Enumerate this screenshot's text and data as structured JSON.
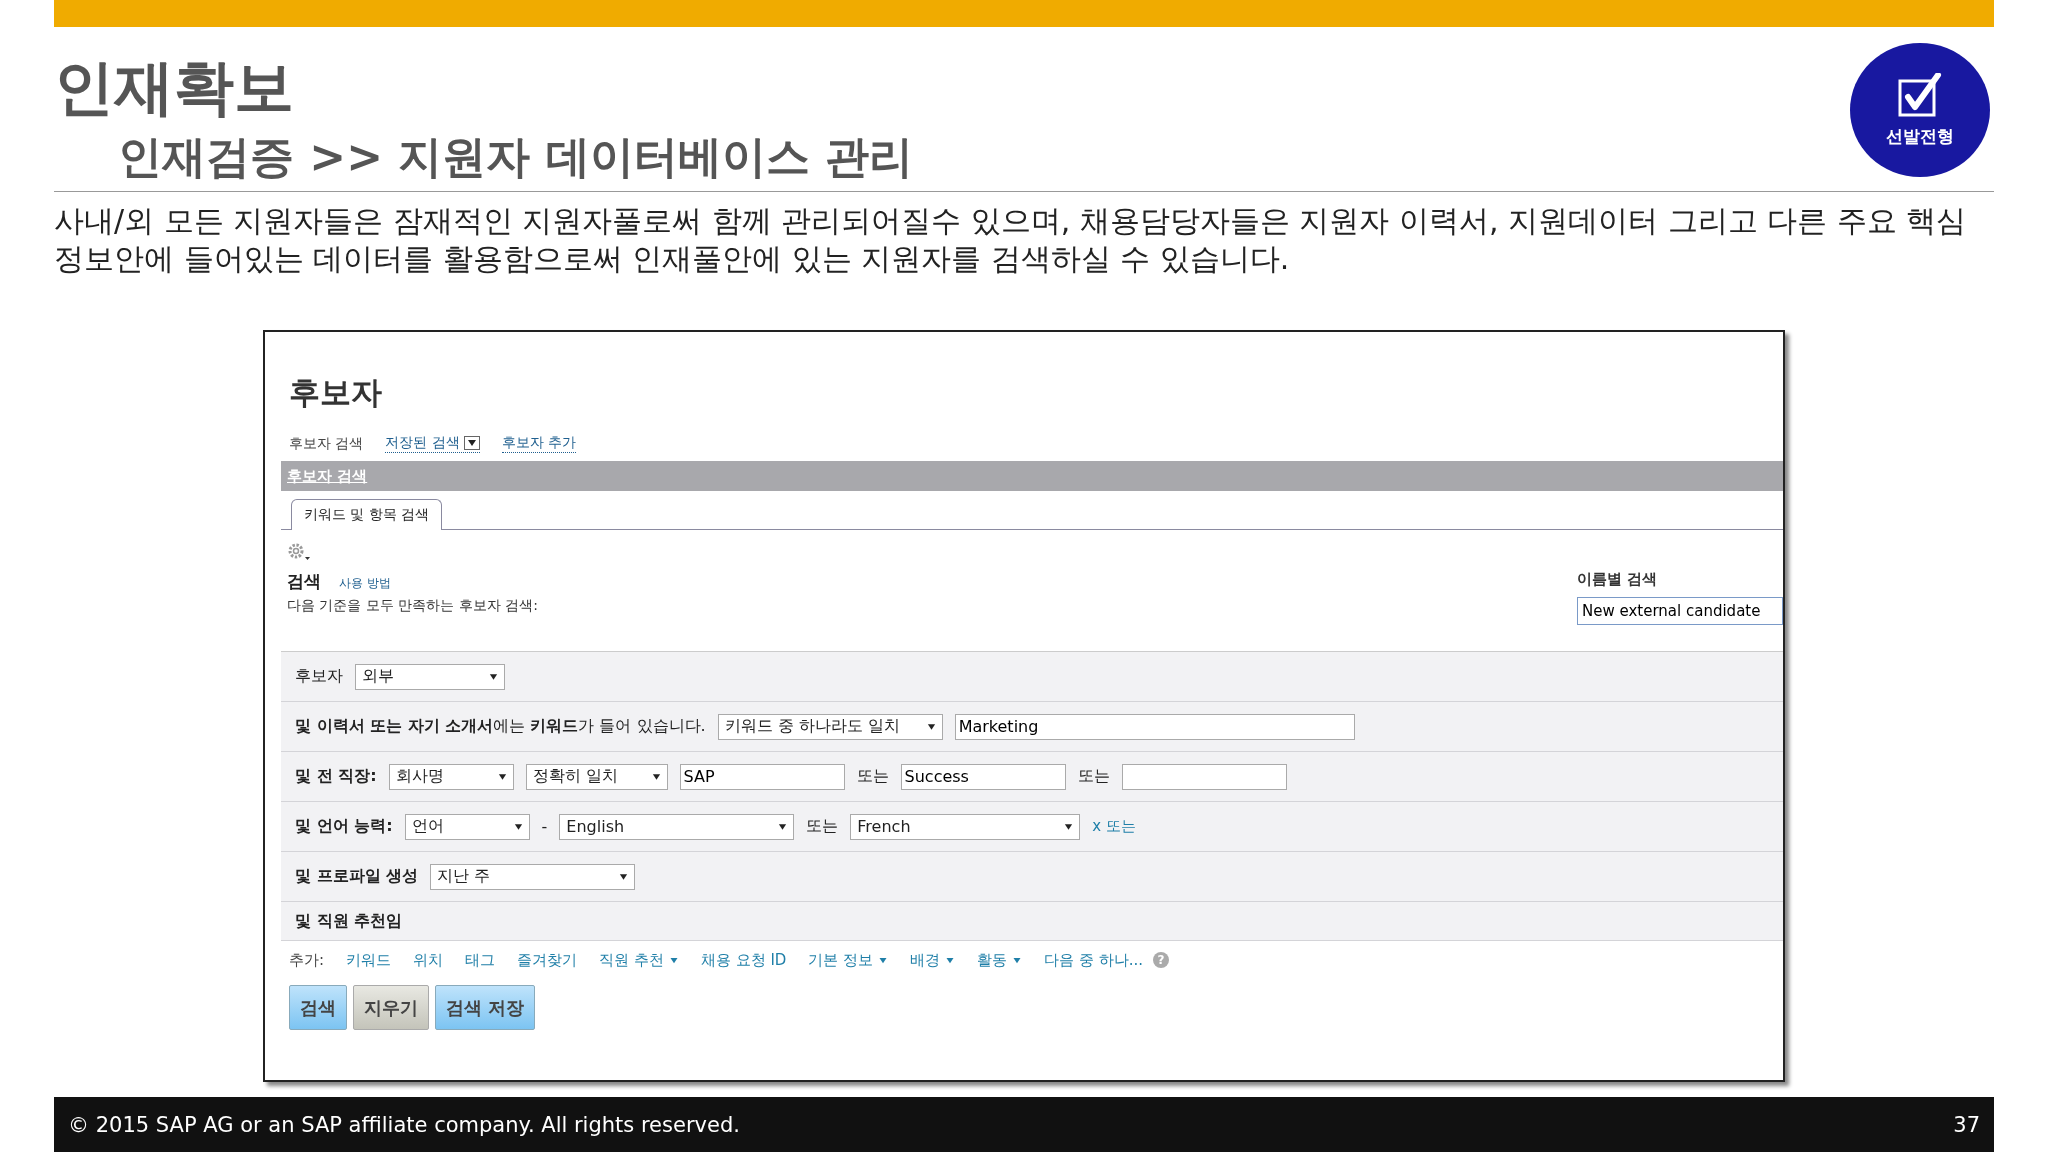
{
  "slide": {
    "title": "인재확보",
    "subtitle": "인재검증 >> 지원자 데이터베이스 관리",
    "badge": {
      "label": "선발전형"
    },
    "description": "사내/외 모든 지원자들은 잠재적인 지원자풀로써 함께 관리되어질수 있으며, 채용담당자들은 지원자 이력서, 지원데이터 그리고 다른 주요 핵심 정보안에 들어있는 데이터를 활용함으로써 인재풀안에 있는 지원자를 검색하실 수 있습니다."
  },
  "app": {
    "page_title": "후보자",
    "nav_links": [
      {
        "label": "후보자 검색",
        "kind": "plain"
      },
      {
        "label": "저장된 검색",
        "kind": "dropdown"
      },
      {
        "label": "후보자 추가",
        "kind": "link"
      }
    ],
    "section_bar": {
      "label": "후보자 검색"
    },
    "tabs": [
      {
        "label": "키워드 및 항목 검색",
        "selected": true
      }
    ],
    "search_heading": "검색",
    "help_link": "사용 방법",
    "criteria_intro": "다음 기준을 모두 만족하는 후보자 검색:",
    "name_search": {
      "label": "이름별 검색",
      "value": "New external candidate"
    },
    "criteria": [
      {
        "parts": [
          {
            "kind": "label",
            "text": "후보자",
            "bold": false
          },
          {
            "kind": "select",
            "value": "외부"
          }
        ]
      },
      {
        "parts": [
          {
            "kind": "label",
            "text": "**및 이력서 또는 자기 소개서**에는 **키워드**가 들어 있습니다.",
            "bold": false
          },
          {
            "kind": "select",
            "value": "키워드 중 하나라도 일치"
          },
          {
            "kind": "input",
            "value": "Marketing"
          }
        ]
      },
      {
        "parts": [
          {
            "kind": "label",
            "text": "및 전 직장:",
            "bold": true
          },
          {
            "kind": "select",
            "value": "회사명"
          },
          {
            "kind": "select",
            "value": "정확히 일치"
          },
          {
            "kind": "input",
            "value": "SAP"
          },
          {
            "kind": "text",
            "text": "또는"
          },
          {
            "kind": "input",
            "value": "Success"
          },
          {
            "kind": "text",
            "text": "또는"
          },
          {
            "kind": "input"
          }
        ]
      },
      {
        "parts": [
          {
            "kind": "label",
            "text": "및 언어 능력:",
            "bold": true
          },
          {
            "kind": "select",
            "value": "언어"
          },
          {
            "kind": "text",
            "text": "-"
          },
          {
            "kind": "select",
            "value": "English"
          },
          {
            "kind": "text",
            "text": "또는"
          },
          {
            "kind": "select",
            "value": "French"
          },
          {
            "kind": "link",
            "text": "x 또는"
          }
        ]
      },
      {
        "parts": [
          {
            "kind": "label",
            "text": "및 프로파일 생성",
            "bold": true
          },
          {
            "kind": "select",
            "value": "지난 주"
          }
        ]
      },
      {
        "parts": [
          {
            "kind": "label",
            "text": "및 직원 추천임",
            "bold": true
          }
        ]
      }
    ],
    "add_label": "추가:",
    "help_icon": "?",
    "add_links": [
      {
        "label": "키워드",
        "dropdown": false
      },
      {
        "label": "위치",
        "dropdown": false
      },
      {
        "label": "태그",
        "dropdown": false
      },
      {
        "label": "즐겨찾기",
        "dropdown": false
      },
      {
        "label": "직원 추천",
        "dropdown": true
      },
      {
        "label": "채용 요청 ID",
        "dropdown": false
      },
      {
        "label": "기본 정보",
        "dropdown": true
      },
      {
        "label": "배경",
        "dropdown": true
      },
      {
        "label": "활동",
        "dropdown": true
      },
      {
        "label": "다음 중 하나...",
        "dropdown": false
      }
    ],
    "buttons": [
      {
        "label": "검색",
        "kind": "primary"
      },
      {
        "label": "지우기",
        "kind": "secondary"
      },
      {
        "label": "검색 저장",
        "kind": "primary"
      }
    ]
  },
  "footer": {
    "copyright": "© 2015 SAP AG or an SAP affiliate company. All rights reserved.",
    "page_number": "37"
  }
}
